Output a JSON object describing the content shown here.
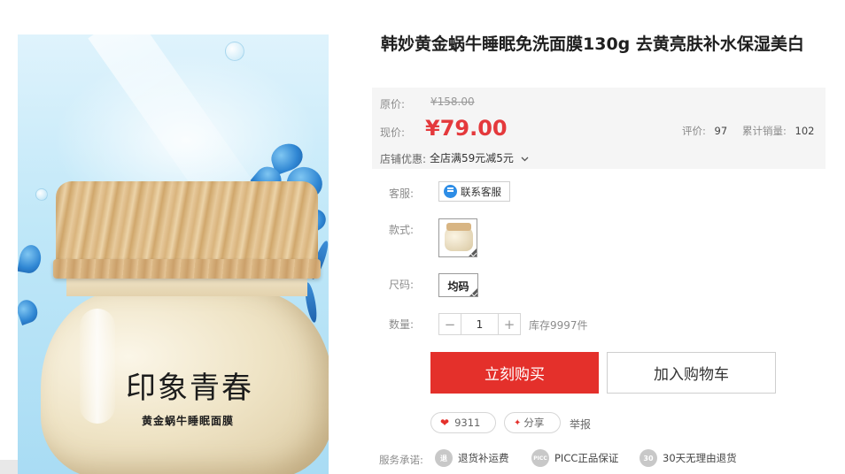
{
  "product": {
    "title": "韩妙黄金蜗牛睡眠免洗面膜130g 去黄亮肤补水保湿美白",
    "image": {
      "brand_text": "印象青春",
      "subtitle_text": "黄金蜗牛睡眠面膜"
    }
  },
  "price_panel": {
    "original_label": "原价:",
    "original_price": "¥158.00",
    "current_label": "现价:",
    "current_price": "¥79.00",
    "reviews_label": "评价:",
    "reviews_count": "97",
    "sales_label": "累计销量:",
    "sales_count": "102",
    "promo_label": "店铺优惠:",
    "promo_value": "全店满59元减5元",
    "promo_icon": "chevron-down-icon"
  },
  "options": {
    "service_label": "客服:",
    "service_button": "联系客服",
    "style_label": "款式:",
    "size_label": "尺码:",
    "size_value": "均码",
    "quantity_label": "数量:",
    "quantity_value": "1",
    "minus": "−",
    "plus": "+",
    "stock_text": "库存9997件"
  },
  "actions": {
    "buy_now": "立刻购买",
    "add_to_cart": "加入购物车",
    "favorite_count": "9311",
    "share_label": "分享",
    "report_label": "举报"
  },
  "service_promise": {
    "label": "服务承诺:",
    "items": [
      {
        "icon_text": "退",
        "text": "退货补运费"
      },
      {
        "icon_text": "PICC",
        "text": "PICC正品保证"
      },
      {
        "icon_text": "30",
        "text": "30天无理由退货"
      }
    ]
  },
  "colors": {
    "accent_red": "#e4302b",
    "price_red": "#e4393c",
    "panel_bg": "#f5f5f5"
  }
}
